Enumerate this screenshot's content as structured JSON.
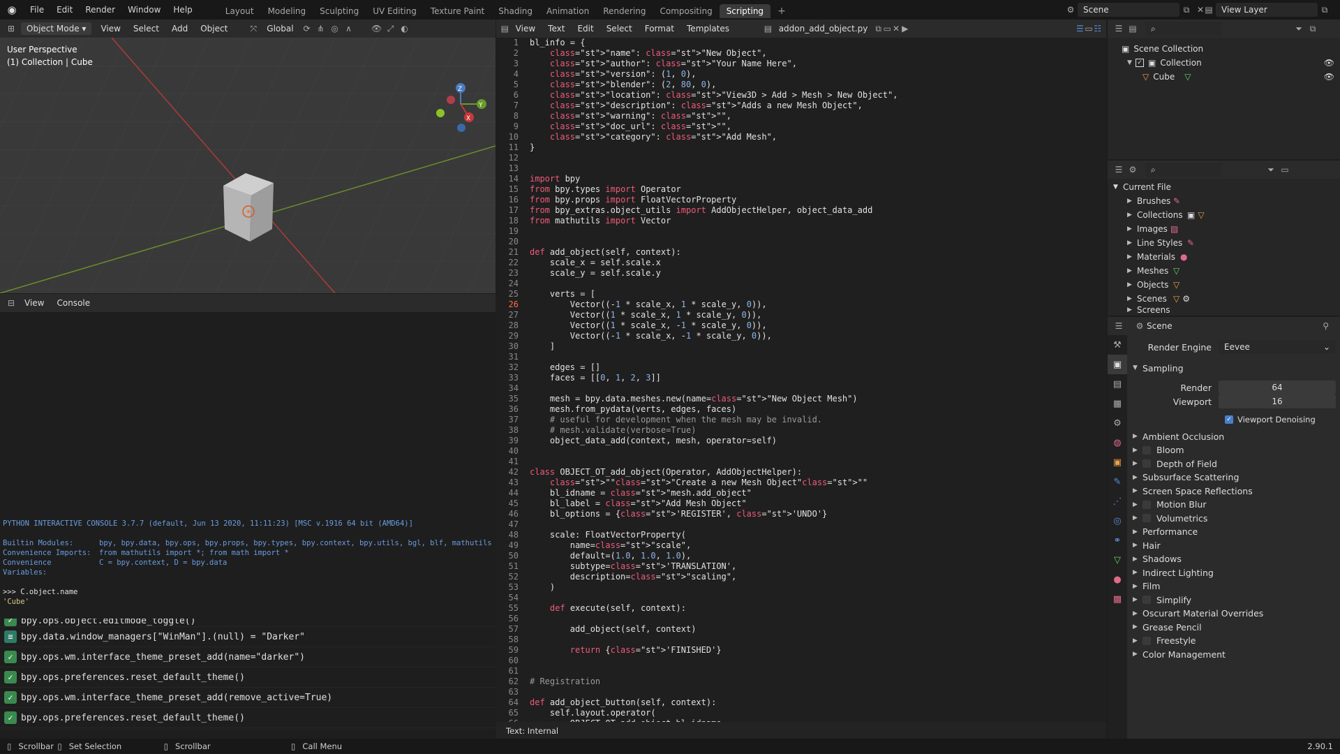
{
  "topbar": {
    "menu": [
      "File",
      "Edit",
      "Render",
      "Window",
      "Help"
    ],
    "workspaces": [
      "Layout",
      "Modeling",
      "Sculpting",
      "UV Editing",
      "Texture Paint",
      "Shading",
      "Animation",
      "Rendering",
      "Compositing",
      "Scripting"
    ],
    "active_workspace": "Scripting",
    "scene": "Scene",
    "view_layer": "View Layer"
  },
  "viewport": {
    "mode": "Object Mode",
    "menu": [
      "View",
      "Select",
      "Add",
      "Object"
    ],
    "transform": "Global",
    "perspective": "User Perspective",
    "collection_info": "(1) Collection | Cube"
  },
  "console": {
    "menu": [
      "View",
      "Console"
    ],
    "banner": "PYTHON INTERACTIVE CONSOLE 3.7.7 (default, Jun 13 2020, 11:11:23) [MSC v.1916 64 bit (AMD64)]",
    "builtin_label": "Builtin Modules:",
    "builtin_value": "bpy, bpy.data, bpy.ops, bpy.props, bpy.types, bpy.context, bpy.utils, bgl, blf, mathutils",
    "imports_label": "Convenience Imports:",
    "imports_value": "from mathutils import *; from math import *",
    "vars_label": "Convenience Variables:",
    "vars_value": "C = bpy.context, D = bpy.data",
    "cmd": ">>> C.object.name",
    "result": "'Cube'",
    "prompt": ">>> "
  },
  "info_log": [
    "bpy.ops.object.editmode_toggle()",
    "bpy.data.window_managers[\"WinMan\"].(null) = \"Darker\"",
    "bpy.ops.wm.interface_theme_preset_add(name=\"darker\")",
    "bpy.ops.preferences.reset_default_theme()",
    "bpy.ops.wm.interface_theme_preset_add(remove_active=True)",
    "bpy.ops.preferences.reset_default_theme()"
  ],
  "text_editor": {
    "menu": [
      "View",
      "Text",
      "Edit",
      "Select",
      "Format",
      "Templates"
    ],
    "filename": "addon_add_object.py",
    "footer": "Text: Internal",
    "current_line": "26",
    "lines": [
      {
        "n": "1",
        "t": "bl_info = {"
      },
      {
        "n": "2",
        "t": "    \"name\": \"New Object\","
      },
      {
        "n": "3",
        "t": "    \"author\": \"Your Name Here\","
      },
      {
        "n": "4",
        "t": "    \"version\": (1, 0),"
      },
      {
        "n": "5",
        "t": "    \"blender\": (2, 80, 0),"
      },
      {
        "n": "6",
        "t": "    \"location\": \"View3D > Add > Mesh > New Object\","
      },
      {
        "n": "7",
        "t": "    \"description\": \"Adds a new Mesh Object\","
      },
      {
        "n": "8",
        "t": "    \"warning\": \"\","
      },
      {
        "n": "9",
        "t": "    \"doc_url\": \"\","
      },
      {
        "n": "10",
        "t": "    \"category\": \"Add Mesh\","
      },
      {
        "n": "11",
        "t": "}"
      },
      {
        "n": "12",
        "t": ""
      },
      {
        "n": "13",
        "t": ""
      },
      {
        "n": "14",
        "t": "import bpy"
      },
      {
        "n": "15",
        "t": "from bpy.types import Operator"
      },
      {
        "n": "16",
        "t": "from bpy.props import FloatVectorProperty"
      },
      {
        "n": "17",
        "t": "from bpy_extras.object_utils import AddObjectHelper, object_data_add"
      },
      {
        "n": "18",
        "t": "from mathutils import Vector"
      },
      {
        "n": "19",
        "t": ""
      },
      {
        "n": "20",
        "t": ""
      },
      {
        "n": "21",
        "t": "def add_object(self, context):"
      },
      {
        "n": "22",
        "t": "    scale_x = self.scale.x"
      },
      {
        "n": "23",
        "t": "    scale_y = self.scale.y"
      },
      {
        "n": "24",
        "t": ""
      },
      {
        "n": "25",
        "t": "    verts = ["
      },
      {
        "n": "26",
        "t": "        Vector((-1 * scale_x, 1 * scale_y, 0)),"
      },
      {
        "n": "27",
        "t": "        Vector((1 * scale_x, 1 * scale_y, 0)),"
      },
      {
        "n": "28",
        "t": "        Vector((1 * scale_x, -1 * scale_y, 0)),"
      },
      {
        "n": "29",
        "t": "        Vector((-1 * scale_x, -1 * scale_y, 0)),"
      },
      {
        "n": "30",
        "t": "    ]"
      },
      {
        "n": "31",
        "t": ""
      },
      {
        "n": "32",
        "t": "    edges = []"
      },
      {
        "n": "33",
        "t": "    faces = [[0, 1, 2, 3]]"
      },
      {
        "n": "34",
        "t": ""
      },
      {
        "n": "35",
        "t": "    mesh = bpy.data.meshes.new(name=\"New Object Mesh\")"
      },
      {
        "n": "36",
        "t": "    mesh.from_pydata(verts, edges, faces)"
      },
      {
        "n": "37",
        "t": "    # useful for development when the mesh may be invalid."
      },
      {
        "n": "38",
        "t": "    # mesh.validate(verbose=True)"
      },
      {
        "n": "39",
        "t": "    object_data_add(context, mesh, operator=self)"
      },
      {
        "n": "40",
        "t": ""
      },
      {
        "n": "41",
        "t": ""
      },
      {
        "n": "42",
        "t": "class OBJECT_OT_add_object(Operator, AddObjectHelper):"
      },
      {
        "n": "43",
        "t": "    \"\"\"Create a new Mesh Object\"\"\""
      },
      {
        "n": "44",
        "t": "    bl_idname = \"mesh.add_object\""
      },
      {
        "n": "45",
        "t": "    bl_label = \"Add Mesh Object\""
      },
      {
        "n": "46",
        "t": "    bl_options = {'REGISTER', 'UNDO'}"
      },
      {
        "n": "47",
        "t": ""
      },
      {
        "n": "48",
        "t": "    scale: FloatVectorProperty("
      },
      {
        "n": "49",
        "t": "        name=\"scale\","
      },
      {
        "n": "50",
        "t": "        default=(1.0, 1.0, 1.0),"
      },
      {
        "n": "51",
        "t": "        subtype='TRANSLATION',"
      },
      {
        "n": "52",
        "t": "        description=\"scaling\","
      },
      {
        "n": "53",
        "t": "    )"
      },
      {
        "n": "54",
        "t": ""
      },
      {
        "n": "55",
        "t": "    def execute(self, context):"
      },
      {
        "n": "56",
        "t": ""
      },
      {
        "n": "57",
        "t": "        add_object(self, context)"
      },
      {
        "n": "58",
        "t": ""
      },
      {
        "n": "59",
        "t": "        return {'FINISHED'}"
      },
      {
        "n": "60",
        "t": ""
      },
      {
        "n": "61",
        "t": ""
      },
      {
        "n": "62",
        "t": "# Registration"
      },
      {
        "n": "63",
        "t": ""
      },
      {
        "n": "64",
        "t": "def add_object_button(self, context):"
      },
      {
        "n": "65",
        "t": "    self.layout.operator("
      },
      {
        "n": "66",
        "t": "        OBJECT_OT_add_object.bl_idname,"
      }
    ]
  },
  "outliner": {
    "scene_collection": "Scene Collection",
    "collection": "Collection",
    "cube": "Cube"
  },
  "data_api": {
    "root": "Current File",
    "items": [
      "Brushes",
      "Collections",
      "Images",
      "Line Styles",
      "Materials",
      "Meshes",
      "Objects",
      "Scenes",
      "Screens"
    ]
  },
  "properties": {
    "context": "Scene",
    "render_engine_label": "Render Engine",
    "render_engine": "Eevee",
    "sampling": "Sampling",
    "render_label": "Render",
    "render_value": "64",
    "viewport_label": "Viewport",
    "viewport_value": "16",
    "denoise": "Viewport Denoising",
    "panels": [
      "Ambient Occlusion",
      "Bloom",
      "Depth of Field",
      "Subsurface Scattering",
      "Screen Space Reflections",
      "Motion Blur",
      "Volumetrics",
      "Performance",
      "Hair",
      "Shadows",
      "Indirect Lighting",
      "Film",
      "Simplify",
      "Oscurart Material Overrides",
      "Grease Pencil",
      "Freestyle",
      "Color Management"
    ]
  },
  "status": {
    "items": [
      "Scrollbar",
      "Set Selection",
      "Scrollbar",
      "Call Menu"
    ],
    "version": "2.90.1"
  }
}
